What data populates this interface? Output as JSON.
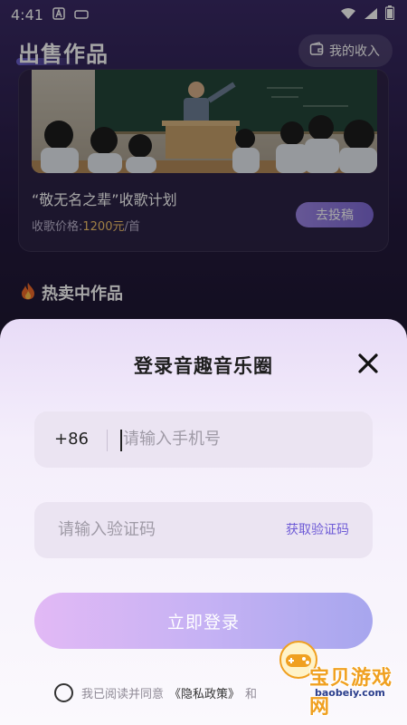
{
  "status_bar": {
    "time": "4:41",
    "icons": [
      "a-icon",
      "rect-icon",
      "wifi-icon",
      "signal-icon",
      "battery-icon"
    ]
  },
  "header": {
    "title": "出售作品",
    "income_label": "我的收入",
    "income_icon": "wallet-icon"
  },
  "promo": {
    "title": "“敬无名之辈”收歌计划",
    "price_label": "收歌价格:",
    "price_value": "1200元",
    "price_unit": "/首",
    "submit_label": "去投稿",
    "image": "classroom-photo"
  },
  "hot_section": {
    "icon": "fire-icon",
    "title": "热卖中作品"
  },
  "login_sheet": {
    "title": "登录音趣音乐圈",
    "close_icon": "close-icon",
    "country_code": "+86",
    "phone_placeholder": "请输入手机号",
    "code_placeholder": "请输入验证码",
    "get_code_label": "获取验证码",
    "login_label": "立即登录",
    "agree_text": "我已阅读并同意",
    "privacy_link": "《隐私政策》",
    "and_text": "和"
  },
  "watermark": {
    "text": "宝贝游戏网",
    "url": "baobeiy.com"
  },
  "colors": {
    "accent": "#7f6ad6",
    "price_highlight": "#f5c36b",
    "link": "#6e5bd6",
    "watermark": "#f0a020"
  }
}
